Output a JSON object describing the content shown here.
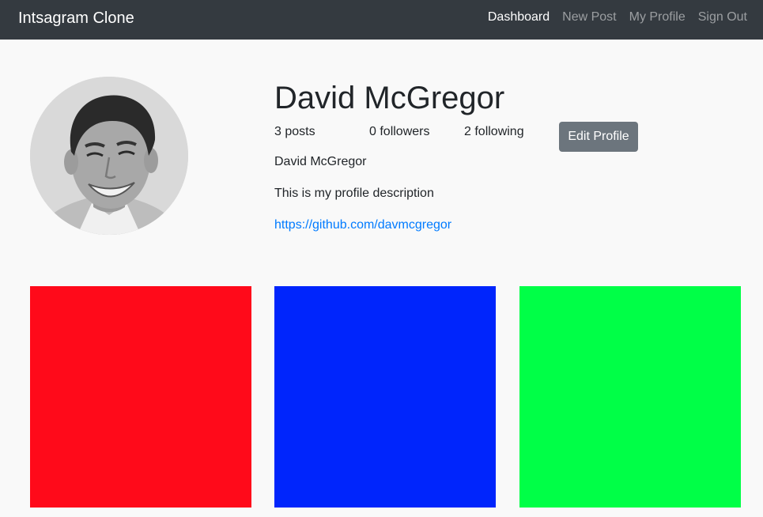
{
  "navbar": {
    "brand": "Intsagram Clone",
    "links": [
      {
        "label": "Dashboard",
        "active": true
      },
      {
        "label": "New Post",
        "active": false
      },
      {
        "label": "My Profile",
        "active": false
      },
      {
        "label": "Sign Out",
        "active": false
      }
    ]
  },
  "profile": {
    "avatar_icon": "profile-photo",
    "username": "David McGregor",
    "stats": {
      "posts": "3 posts",
      "followers": "0 followers",
      "following": "2 following"
    },
    "edit_button_label": "Edit Profile",
    "full_name": "David McGregor",
    "description": "This is my profile description",
    "website": "https://github.com/davmcgregor"
  },
  "posts": [
    {
      "color": "#ff0a1a"
    },
    {
      "color": "#0025fc"
    },
    {
      "color": "#00ff47"
    }
  ],
  "colors": {
    "navbar_bg": "#343a40",
    "page_bg": "#f9f9f9",
    "link": "#007bff",
    "button_bg": "#6c757d"
  }
}
